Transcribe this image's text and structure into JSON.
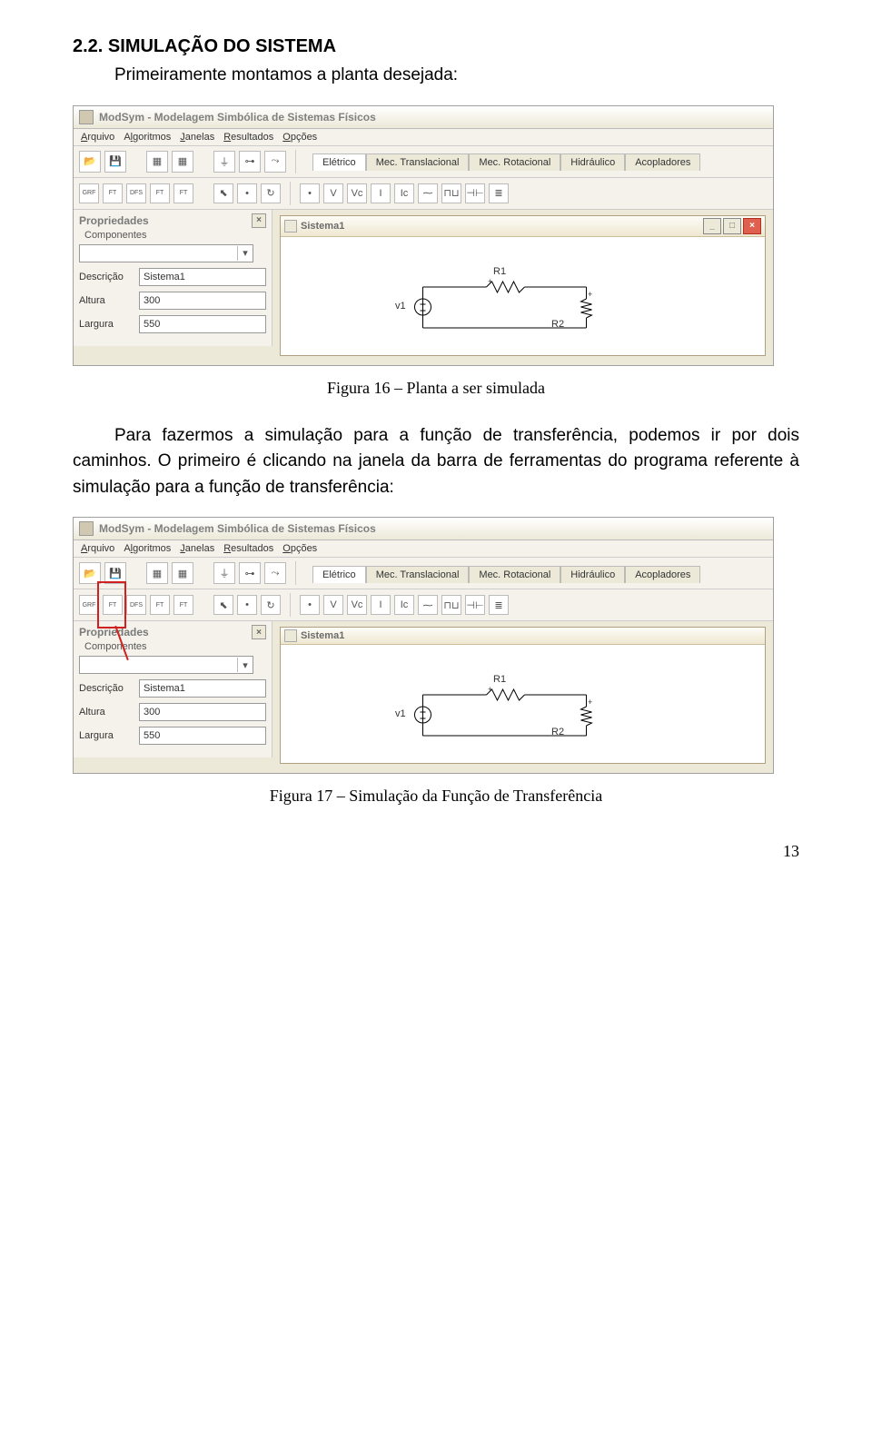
{
  "section_number": "2.2. SIMULAÇÃO DO SISTEMA",
  "intro_text": "Primeiramente montamos a planta desejada:",
  "fig16_caption": "Figura 16 – Planta a ser simulada",
  "paragraph2": "Para fazermos a simulação para a função de transferência, podemos ir por dois caminhos. O primeiro é clicando na janela da barra de ferramentas do programa referente à simulação para a função de transferência:",
  "fig17_caption": "Figura 17 – Simulação da Função de Transferência",
  "page_number": "13",
  "app": {
    "title": "ModSym - Modelagem Simbólica de Sistemas Físicos",
    "menus": [
      "Arquivo",
      "Algoritmos",
      "Janelas",
      "Resultados",
      "Opções"
    ],
    "domain_tabs": [
      "Elétrico",
      "Mec. Translacional",
      "Mec. Rotacional",
      "Hidráulico",
      "Acopladores"
    ],
    "toolbar2_labels": [
      "GRF",
      "FT",
      "DFS",
      "FT",
      "FT"
    ],
    "elec_icons": [
      "•",
      "V",
      "Vc",
      "I",
      "Ic",
      "⁓",
      "⊓⊔",
      "⊣⊢",
      "≣"
    ],
    "props": {
      "panel_title": "Propriedades",
      "group": "Componentes",
      "fields": [
        {
          "label": "Descrição",
          "value": "Sistema1"
        },
        {
          "label": "Altura",
          "value": "300"
        },
        {
          "label": "Largura",
          "value": "550"
        }
      ]
    },
    "subwindow_title": "Sistema1",
    "circuit": {
      "r1": "R1",
      "r2": "R2",
      "v1": "v1",
      "plus": "+",
      "source_symbol": "±"
    }
  }
}
